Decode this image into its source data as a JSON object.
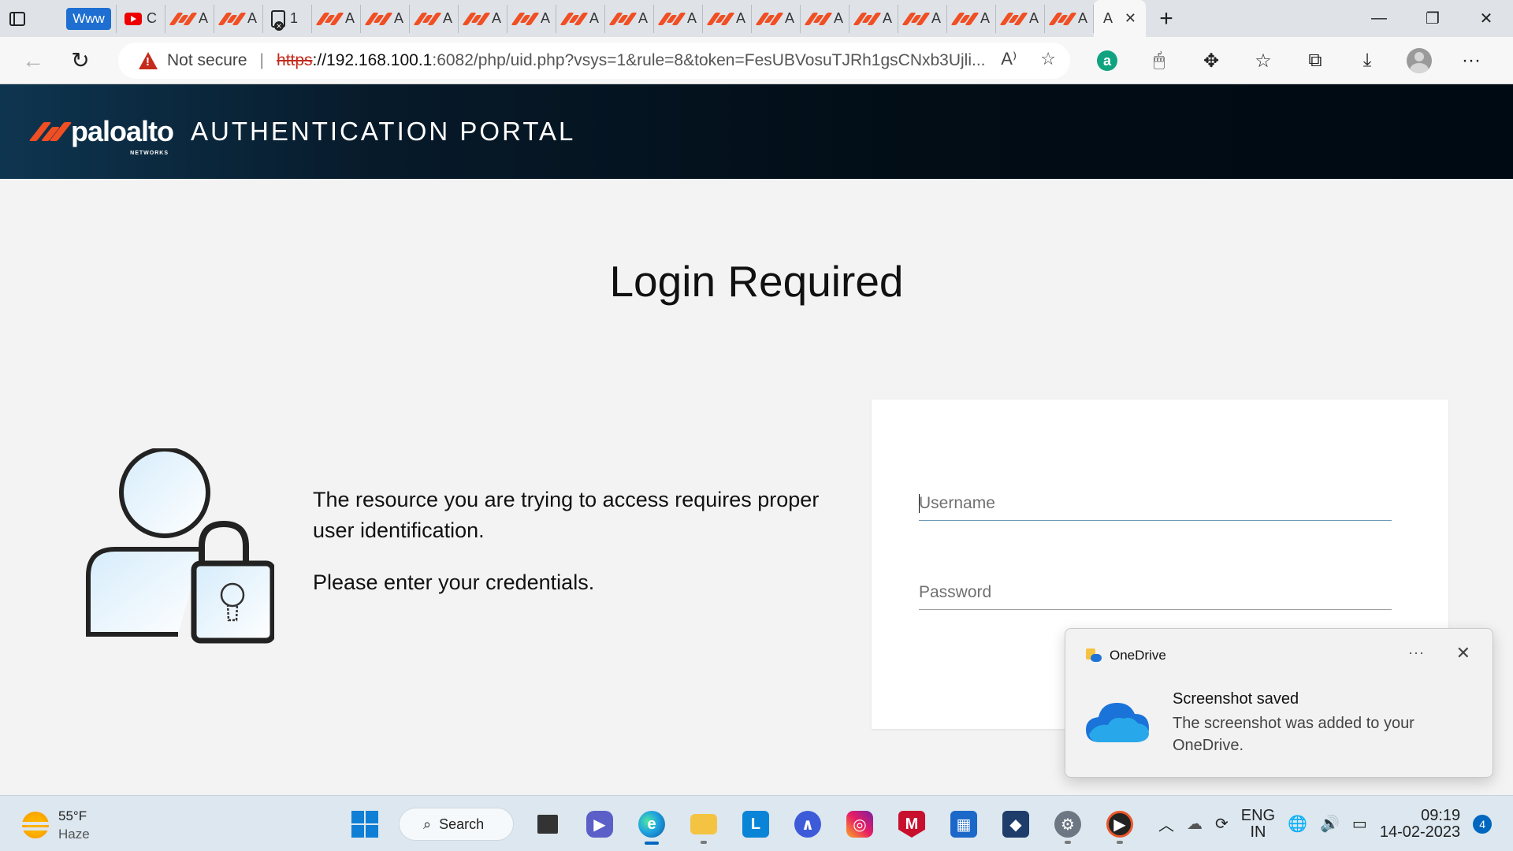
{
  "browser": {
    "tabs": [
      {
        "kind": "www",
        "label": "Www"
      },
      {
        "kind": "youtube",
        "label": "C"
      },
      {
        "kind": "pa",
        "label": "A"
      },
      {
        "kind": "pa",
        "label": "A"
      },
      {
        "kind": "doc",
        "label": "1"
      },
      {
        "kind": "pa",
        "label": "A"
      },
      {
        "kind": "pa",
        "label": "A"
      },
      {
        "kind": "pa",
        "label": "A"
      },
      {
        "kind": "pa",
        "label": "A"
      },
      {
        "kind": "pa",
        "label": "A"
      },
      {
        "kind": "pa",
        "label": "A"
      },
      {
        "kind": "pa",
        "label": "A"
      },
      {
        "kind": "pa",
        "label": "A"
      },
      {
        "kind": "pa",
        "label": "A"
      },
      {
        "kind": "pa",
        "label": "A"
      },
      {
        "kind": "pa",
        "label": "A"
      },
      {
        "kind": "pa",
        "label": "A"
      },
      {
        "kind": "pa",
        "label": "A"
      },
      {
        "kind": "pa",
        "label": "A"
      },
      {
        "kind": "pa",
        "label": "A"
      },
      {
        "kind": "pa",
        "label": "A"
      }
    ],
    "active_tab_label": "A",
    "security_label": "Not secure",
    "url": {
      "protocol": "https",
      "host": "://192.168.100.1",
      "rest": ":6082/php/uid.php?vsys=1&rule=8&token=FesUBVosuTJRh1gsCNxb3Ujli..."
    }
  },
  "portal": {
    "brand": "paloalto",
    "brand_sub": "NETWORKS",
    "title": "AUTHENTICATION PORTAL",
    "heading": "Login Required",
    "message_1": "The resource you are trying to access requires proper user identification.",
    "message_2": "Please enter your credentials.",
    "username_placeholder": "Username",
    "password_placeholder": "Password"
  },
  "toast": {
    "app": "OneDrive",
    "more": "···",
    "title": "Screenshot saved",
    "body": "The screenshot was added to your OneDrive."
  },
  "taskbar": {
    "temperature": "55°F",
    "condition": "Haze",
    "search_label": "Search",
    "lang_1": "ENG",
    "lang_2": "IN",
    "time": "09:19",
    "date": "14-02-2023",
    "notification_count": "4"
  },
  "colors": {
    "brand_orange": "#f04e23",
    "header_dark": "#020d16",
    "warning_red": "#c42b1c",
    "accent_blue": "#0067c0"
  }
}
